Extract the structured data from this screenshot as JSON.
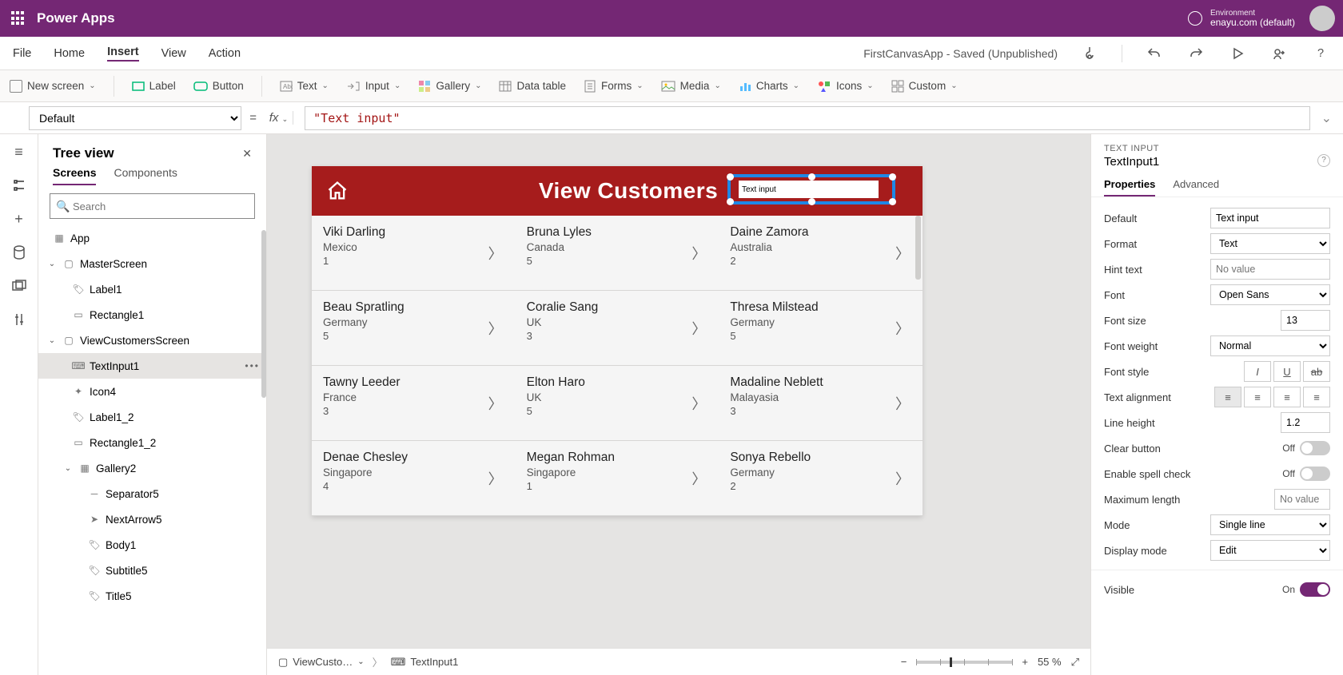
{
  "brand": "Power Apps",
  "env": {
    "label": "Environment",
    "value": "enayu.com (default)"
  },
  "menus": {
    "file": "File",
    "home": "Home",
    "insert": "Insert",
    "view": "View",
    "action": "Action"
  },
  "save_status": "FirstCanvasApp - Saved (Unpublished)",
  "ribbon": {
    "new_screen": "New screen",
    "label": "Label",
    "button": "Button",
    "text": "Text",
    "input": "Input",
    "gallery": "Gallery",
    "data_table": "Data table",
    "forms": "Forms",
    "media": "Media",
    "charts": "Charts",
    "icons": "Icons",
    "custom": "Custom"
  },
  "fbar": {
    "prop": "Default",
    "formula": "\"Text input\""
  },
  "tree": {
    "title": "Tree view",
    "tabs": {
      "screens": "Screens",
      "components": "Components"
    },
    "search_placeholder": "Search",
    "nodes": {
      "app": "App",
      "master": "MasterScreen",
      "label1": "Label1",
      "rect1": "Rectangle1",
      "view": "ViewCustomersScreen",
      "textinput1": "TextInput1",
      "icon4": "Icon4",
      "label1_2": "Label1_2",
      "rect1_2": "Rectangle1_2",
      "gallery2": "Gallery2",
      "sep5": "Separator5",
      "next5": "NextArrow5",
      "body1": "Body1",
      "sub5": "Subtitle5",
      "title5": "Title5"
    }
  },
  "canvas": {
    "header_title": "View Customers",
    "selected_value": "Text input",
    "rows": [
      [
        {
          "name": "Viki  Darling",
          "country": "Mexico",
          "num": "1"
        },
        {
          "name": "Bruna  Lyles",
          "country": "Canada",
          "num": "5"
        },
        {
          "name": "Daine  Zamora",
          "country": "Australia",
          "num": "2"
        }
      ],
      [
        {
          "name": "Beau  Spratling",
          "country": "Germany",
          "num": "5"
        },
        {
          "name": "Coralie  Sang",
          "country": "UK",
          "num": "3"
        },
        {
          "name": "Thresa  Milstead",
          "country": "Germany",
          "num": "5"
        }
      ],
      [
        {
          "name": "Tawny  Leeder",
          "country": "France",
          "num": "3"
        },
        {
          "name": "Elton  Haro",
          "country": "UK",
          "num": "5"
        },
        {
          "name": "Madaline  Neblett",
          "country": "Malayasia",
          "num": "3"
        }
      ],
      [
        {
          "name": "Denae  Chesley",
          "country": "Singapore",
          "num": "4"
        },
        {
          "name": "Megan  Rohman",
          "country": "Singapore",
          "num": "1"
        },
        {
          "name": "Sonya  Rebello",
          "country": "Germany",
          "num": "2"
        }
      ]
    ]
  },
  "statusbar": {
    "crumb1": "ViewCusto…",
    "crumb2": "TextInput1",
    "zoom": "55  %"
  },
  "props": {
    "type": "TEXT INPUT",
    "name": "TextInput1",
    "tabs": {
      "properties": "Properties",
      "advanced": "Advanced"
    },
    "labels": {
      "default": "Default",
      "format": "Format",
      "hint": "Hint text",
      "font": "Font",
      "font_size": "Font size",
      "font_weight": "Font weight",
      "font_style": "Font style",
      "text_align": "Text alignment",
      "line_height": "Line height",
      "clear": "Clear button",
      "spell": "Enable spell check",
      "maxlen": "Maximum length",
      "mode": "Mode",
      "display_mode": "Display mode",
      "visible": "Visible"
    },
    "values": {
      "default": "Text input",
      "format": "Text",
      "hint_ph": "No value",
      "font": "Open Sans",
      "font_size": "13",
      "font_weight": "Normal",
      "line_height": "1.2",
      "maxlen_ph": "No value",
      "mode": "Single line",
      "display_mode": "Edit",
      "off": "Off",
      "on": "On"
    }
  }
}
